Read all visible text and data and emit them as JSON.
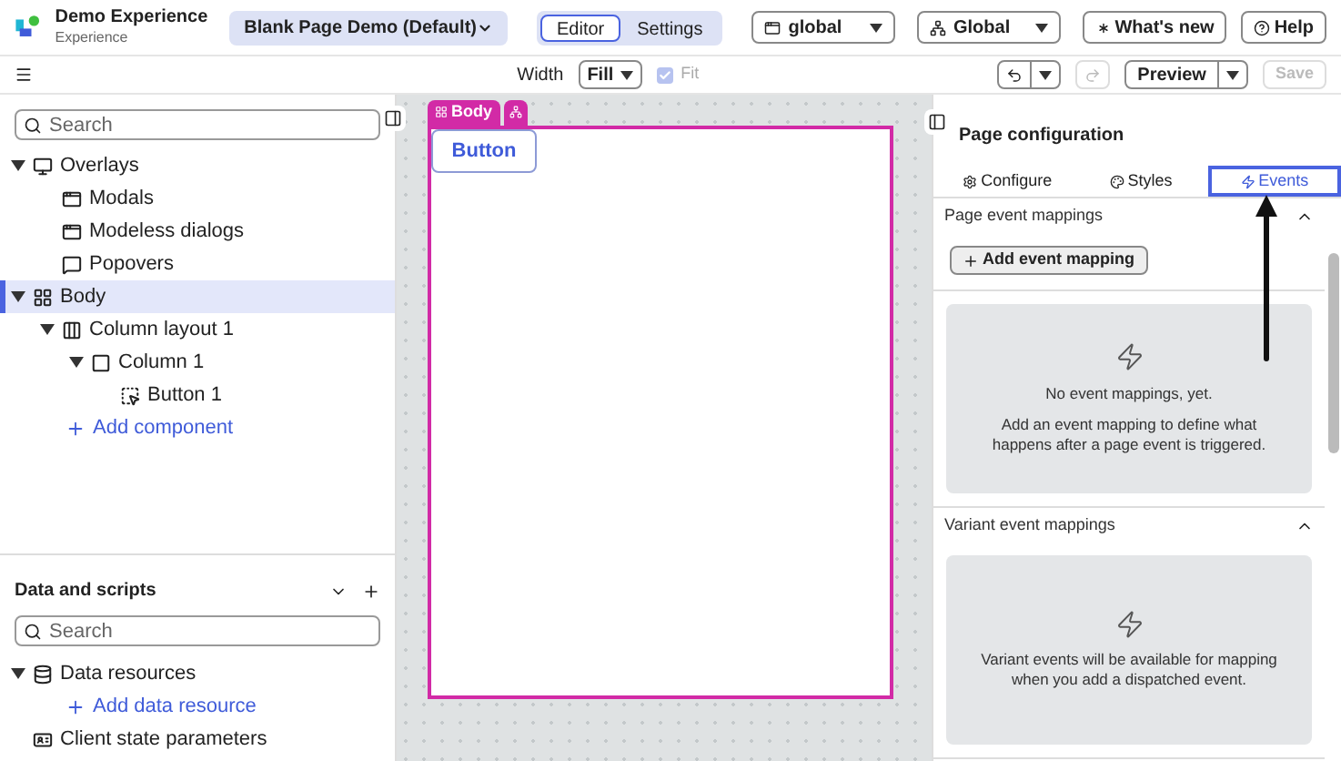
{
  "header": {
    "app_title": "Demo Experience",
    "app_subtitle": "Experience",
    "page_selector": "Blank Page Demo (Default)",
    "mode_tabs": [
      {
        "label": "Editor",
        "selected": true
      },
      {
        "label": "Settings",
        "selected": false
      }
    ],
    "scopes": [
      {
        "kind": "app",
        "label": "global"
      },
      {
        "kind": "tree",
        "label": "Global"
      }
    ],
    "buttons": [
      {
        "kind": "star",
        "label": "What's new"
      },
      {
        "kind": "help",
        "label": "Help"
      }
    ]
  },
  "toolbar": {
    "width_label": "Width",
    "width_value": "Fill",
    "fit": {
      "label": "Fit",
      "checked": true,
      "disabled": true
    },
    "preview": "Preview",
    "save": {
      "label": "Save",
      "disabled": true
    }
  },
  "outline": {
    "search_placeholder": "Search",
    "tree": [
      {
        "kind": "overlay",
        "label": "Overlays",
        "expanded": true,
        "selected": false,
        "children": [
          {
            "kind": "modal",
            "label": "Modals",
            "selected": false
          },
          {
            "kind": "modeless",
            "label": "Modeless dialogs",
            "selected": false
          },
          {
            "kind": "popover",
            "label": "Popovers",
            "selected": false
          }
        ]
      },
      {
        "kind": "body",
        "label": "Body",
        "expanded": true,
        "selected": true,
        "children": [
          {
            "kind": "columns",
            "label": "Column layout 1",
            "expanded": true,
            "selected": false,
            "children": [
              {
                "kind": "column",
                "label": "Column 1",
                "expanded": true,
                "selected": false,
                "children": [
                  {
                    "kind": "button",
                    "label": "Button 1",
                    "selected": false
                  }
                ]
              }
            ]
          },
          {
            "kind": "link",
            "label": "Add component",
            "selected": false
          }
        ]
      }
    ]
  },
  "data_scripts": {
    "title": "Data and scripts",
    "search_placeholder": "Search",
    "tree": [
      {
        "kind": "database",
        "label": "Data resources",
        "expanded": true,
        "selected": false,
        "children": [
          {
            "kind": "link",
            "label": "Add data resource",
            "selected": false
          }
        ]
      },
      {
        "kind": "state",
        "label": "Client state parameters",
        "selected": false
      }
    ]
  },
  "canvas": {
    "body_tag": "Body",
    "button": "Button"
  },
  "config": {
    "title": "Page configuration",
    "tabs": [
      {
        "kind": "gear",
        "label": "Configure",
        "selected": false
      },
      {
        "kind": "palette",
        "label": "Styles",
        "selected": false
      },
      {
        "kind": "bolt",
        "label": "Events",
        "selected": true
      }
    ],
    "sections": [
      {
        "title": "Page event mappings",
        "expanded": true,
        "action": "Add event mapping",
        "empty_title": "No event mappings, yet.",
        "empty_text": "Add an event mapping to define what happens after a page event is triggered."
      },
      {
        "title": "Variant event mappings",
        "expanded": true,
        "empty_text": "Variant events will be available for mapping when you add a dispatched event."
      }
    ]
  }
}
